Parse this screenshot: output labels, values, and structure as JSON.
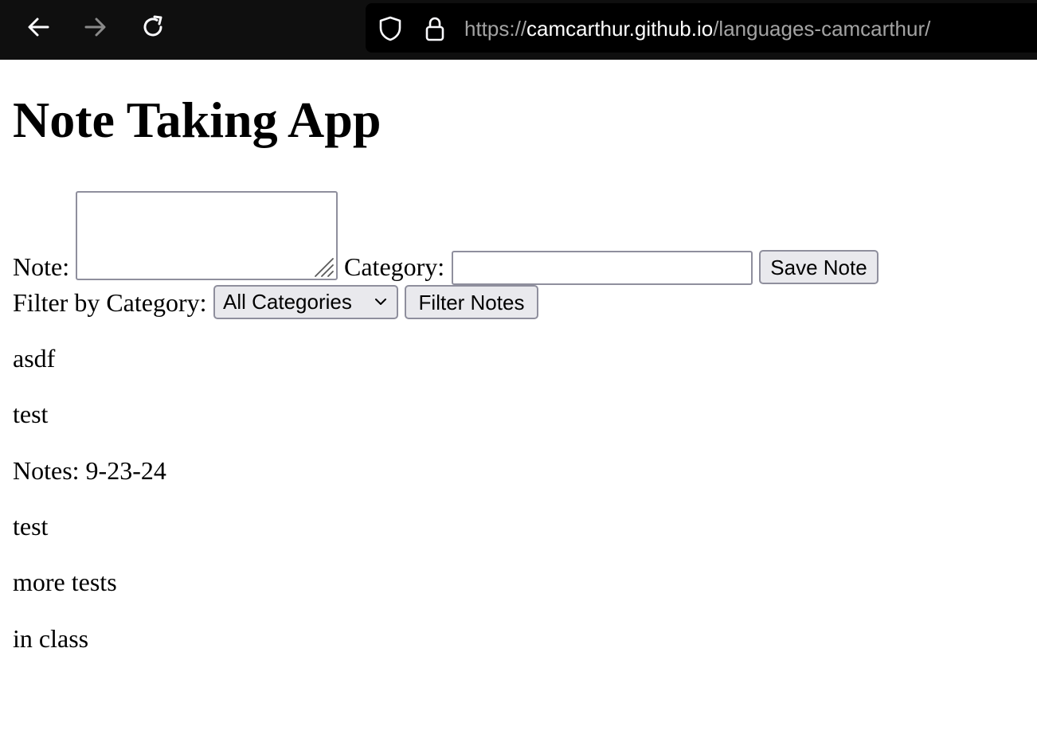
{
  "browser": {
    "url_scheme": "https://",
    "url_host": "camcarthur.github.io",
    "url_path": "/languages-camcarthur/",
    "icons": [
      "back-arrow-icon",
      "forward-arrow-icon",
      "reload-icon",
      "shield-icon",
      "lock-icon"
    ],
    "colors": {
      "toolbar": "#0f0f0f",
      "urlbar": "#000000",
      "url_dim": "#a3a3a3",
      "url_bright": "#ffffff"
    }
  },
  "page": {
    "title": "Note Taking App",
    "form": {
      "note_label": "Note:",
      "note_value": "",
      "category_label": "Category:",
      "category_value": "",
      "save_label": "Save Note"
    },
    "filter": {
      "label": "Filter by Category:",
      "selected": "All Categories",
      "button_label": "Filter Notes"
    },
    "notes": [
      "asdf",
      "test",
      "Notes: 9-23-24",
      "test",
      "more tests",
      "in class"
    ]
  },
  "colors": {
    "control_border": "#8f8f9d",
    "button_bg": "#e9e9ed",
    "text": "#000000"
  }
}
